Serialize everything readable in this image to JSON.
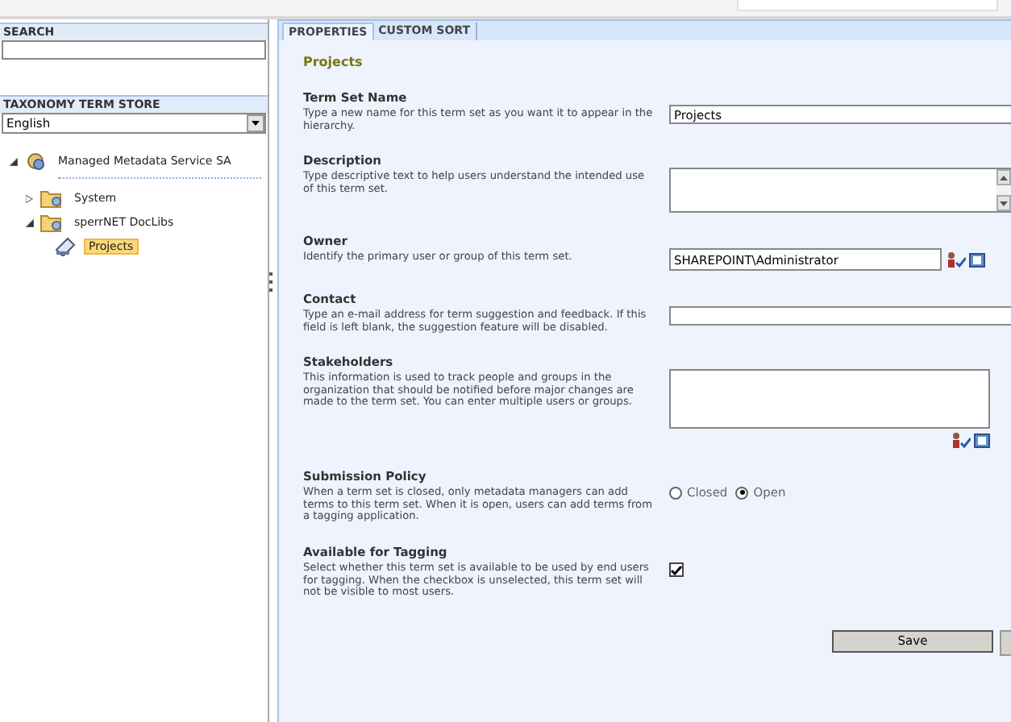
{
  "search": {
    "label": "SEARCH"
  },
  "term_store": {
    "label": "TAXONOMY TERM STORE",
    "language": "English"
  },
  "tree": [
    {
      "label": "Managed Metadata Service SA",
      "expanded": true,
      "selected": false,
      "children": [
        {
          "label": "System",
          "expanded": false,
          "selected": false
        },
        {
          "label": "sperrNET DocLibs",
          "expanded": true,
          "selected": false,
          "children": [
            {
              "label": "Projects",
              "selected": true
            }
          ]
        }
      ]
    }
  ],
  "tabs": [
    {
      "label": "PROPERTIES",
      "selected": true
    },
    {
      "label": "CUSTOM SORT",
      "selected": false
    }
  ],
  "heading": "Projects",
  "sections": [
    {
      "kind": "text",
      "title": "Term Set Name",
      "description": "Type a new name for this term set as you want it to appear in the hierarchy.",
      "value": "Projects"
    },
    {
      "kind": "textarea",
      "title": "Description",
      "description": "Type descriptive text to help users understand the intended use of this term set."
    },
    {
      "kind": "people",
      "title": "Owner",
      "description": "Identify the primary user or group of this term set.",
      "value": "SHAREPOINT\\Administrator"
    },
    {
      "kind": "text",
      "title": "Contact",
      "description": "Type an e-mail address for term suggestion and feedback. If this field is left blank, the suggestion feature will be disabled."
    },
    {
      "kind": "people-area",
      "title": "Stakeholders",
      "description": "This information is used to track people and groups in the organization that should be notified before major changes are made to the term set. You can enter multiple users or groups."
    },
    {
      "kind": "radio",
      "title": "Submission Policy",
      "description": "When a term set is closed, only metadata managers can add terms to this term set. When it is open, users can add terms from a tagging application.",
      "options": [
        {
          "label": "Closed",
          "selected": false
        },
        {
          "label": "Open",
          "selected": true
        }
      ]
    },
    {
      "kind": "checkbox",
      "title": "Available for Tagging",
      "description": "Select whether this term set is available to be used by end users for tagging. When the checkbox is unselected, this term set will not be visible to most users.",
      "checked": true
    }
  ],
  "save_button": "Save"
}
